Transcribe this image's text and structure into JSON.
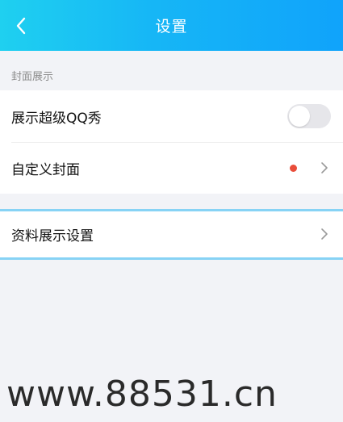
{
  "header": {
    "back_icon": "chevron-left-icon",
    "title": "设置"
  },
  "section": {
    "label": "封面展示",
    "items": [
      {
        "label": "展示超级QQ秀",
        "control": "toggle",
        "toggle_on": false
      },
      {
        "label": "自定义封面",
        "control": "chevron",
        "badge": "red-dot"
      }
    ]
  },
  "profile_display": {
    "label": "资料展示设置",
    "control": "chevron"
  },
  "watermark": "www.88531.cn",
  "colors": {
    "header_start": "#1fd0f0",
    "header_end": "#10a3fb",
    "badge": "#e94d3a",
    "highlight_border": "#87d3f5"
  }
}
